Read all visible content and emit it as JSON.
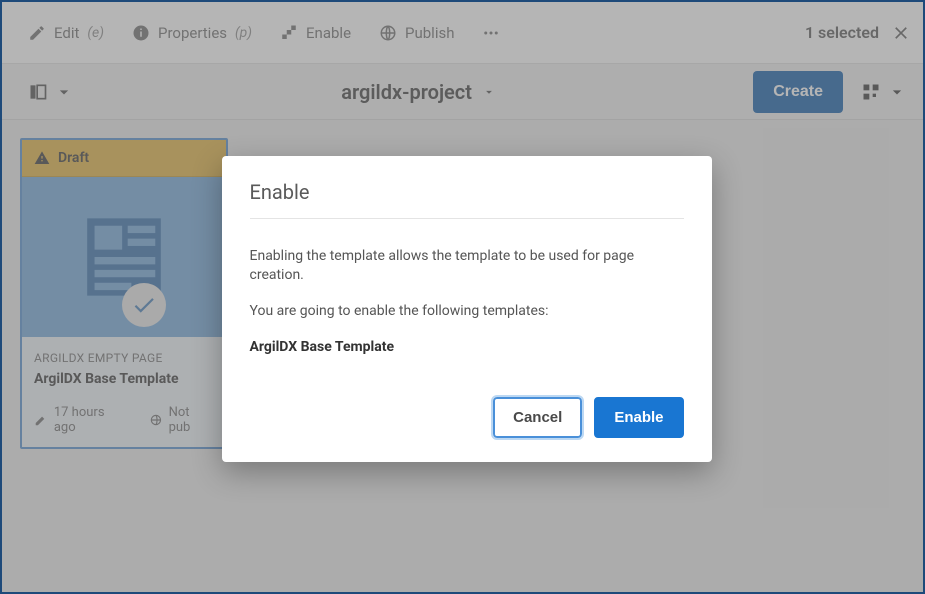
{
  "action_bar": {
    "items": [
      {
        "label": "Edit",
        "shortcut": "(e)"
      },
      {
        "label": "Properties",
        "shortcut": "(p)"
      },
      {
        "label": "Enable",
        "shortcut": ""
      },
      {
        "label": "Publish",
        "shortcut": ""
      }
    ],
    "selected_label": "1 selected"
  },
  "filter_bar": {
    "breadcrumb": "argildx-project",
    "create_label": "Create"
  },
  "card": {
    "status": "Draft",
    "type_label": "ARGILDX EMPTY PAGE",
    "title": "ArgilDX Base Template",
    "modified": "17 hours ago",
    "publish_state": "Not pub"
  },
  "dialog": {
    "title": "Enable",
    "line1": "Enabling the template allows the template to be used for page creation.",
    "line2": "You are going to enable the following templates:",
    "template_name": "ArgilDX Base Template",
    "cancel": "Cancel",
    "confirm": "Enable"
  }
}
